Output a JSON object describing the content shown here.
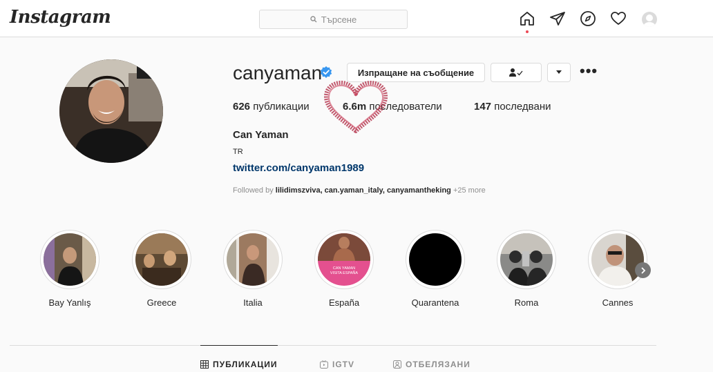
{
  "header": {
    "logo": "Instagram",
    "search_placeholder": "Търсене"
  },
  "profile": {
    "username": "canyaman",
    "verified": true,
    "message_button": "Изпращане на съобщение",
    "following_button_icon": "person-check-icon",
    "dropdown_icon": "chevron-down-icon",
    "more_icon": "ellipsis-icon",
    "posts_count": "626",
    "posts_label": "публикации",
    "followers_count": "6.6m",
    "followers_label": "последователи",
    "following_count": "147",
    "following_label": "последвани",
    "full_name": "Can Yaman",
    "bio": "TR",
    "link": "twitter.com/canyaman1989",
    "followed_by_prefix": "Followed by",
    "followed_by_users": "lilidimszviva, can.yaman_italy, canyamantheking",
    "followed_by_more": "+25 more"
  },
  "highlights": [
    {
      "label": "Bay Yanlış"
    },
    {
      "label": "Greece"
    },
    {
      "label": "Italia"
    },
    {
      "label": "España",
      "text_lines": [
        "CAN YAMAN",
        "VISITA ESPAÑA"
      ]
    },
    {
      "label": "Quarantena"
    },
    {
      "label": "Roma"
    },
    {
      "label": "Cannes"
    }
  ],
  "tabs": [
    {
      "label": "ПУБЛИКАЦИИ",
      "icon": "grid-icon",
      "active": true
    },
    {
      "label": "IGTV",
      "icon": "igtv-icon",
      "active": false
    },
    {
      "label": "ОТБЕЛЯЗАНИ",
      "icon": "tagged-icon",
      "active": false
    }
  ],
  "colors": {
    "verified_blue": "#3897f0",
    "link_blue": "#00376b",
    "notification_red": "#ed4956",
    "doodle_heart": "#b3314a"
  }
}
